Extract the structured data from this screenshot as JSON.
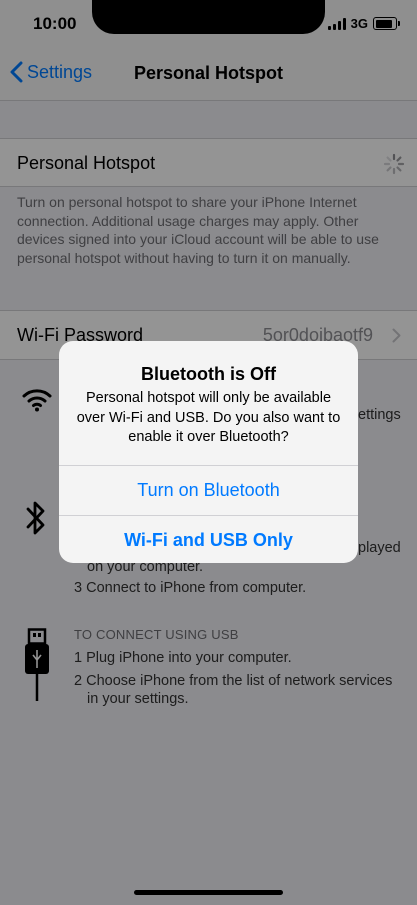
{
  "status_bar": {
    "time": "10:00",
    "network": "3G"
  },
  "nav": {
    "back_label": "Settings",
    "title": "Personal Hotspot"
  },
  "hotspot": {
    "label": "Personal Hotspot",
    "footer": "Turn on personal hotspot to share your iPhone Internet connection. Additional usage charges may apply. Other devices signed into your iCloud account will be able to use personal hotspot without having to turn it on manually."
  },
  "wifi_password": {
    "label": "Wi-Fi Password",
    "value": "5or0doibaotf9"
  },
  "instructions": {
    "wifi_fragment": "ettings",
    "bluetooth_fragment_1": "played",
    "bluetooth_fragment_2": "on your computer.",
    "bluetooth_step3": "3 Connect to iPhone from computer.",
    "usb_heading": "TO CONNECT USING USB",
    "usb_step1": "1 Plug iPhone into your computer.",
    "usb_step2_line1": "2 Choose iPhone from the list of network services",
    "usb_step2_line2": "in your settings."
  },
  "alert": {
    "title": "Bluetooth is Off",
    "message": "Personal hotspot will only be available over Wi-Fi and USB. Do you also want to enable it over Bluetooth?",
    "button_primary": "Turn on Bluetooth",
    "button_secondary": "Wi-Fi and USB Only"
  },
  "colors": {
    "accent": "#007aff",
    "background": "#efeff4",
    "dim_overlay": "rgba(0,0,0,0.42)"
  },
  "icons": [
    "chevron-left-icon",
    "spinner-icon",
    "chevron-right-icon",
    "wifi-icon",
    "bluetooth-icon",
    "usb-cable-icon",
    "signal-icon",
    "battery-icon"
  ]
}
